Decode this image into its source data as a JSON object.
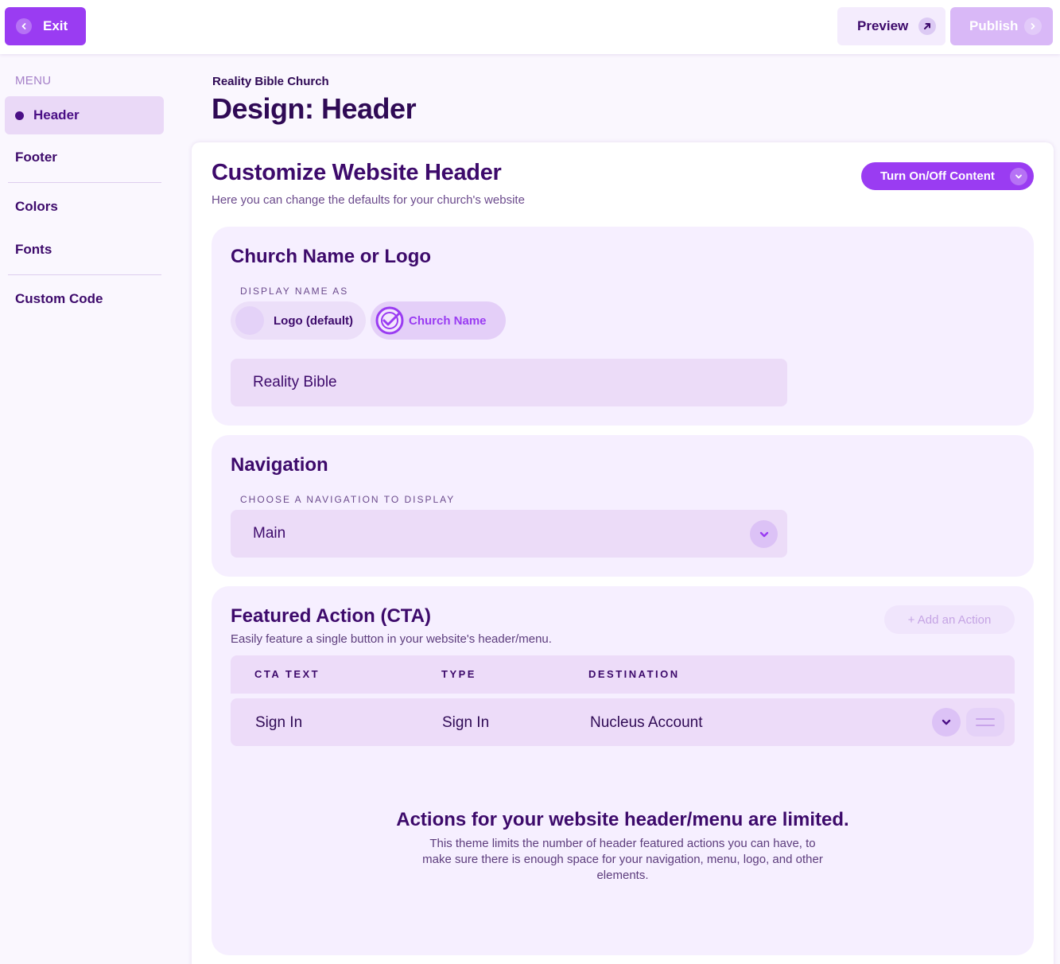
{
  "topbar": {
    "exit_label": "Exit",
    "preview_label": "Preview",
    "publish_label": "Publish"
  },
  "sidebar": {
    "menu_label": "MENU",
    "items": [
      {
        "label": "Header",
        "active": true
      },
      {
        "label": "Footer"
      },
      {
        "label": "Colors"
      },
      {
        "label": "Fonts"
      },
      {
        "label": "Custom Code"
      }
    ]
  },
  "page": {
    "org_name": "Reality Bible Church",
    "title": "Design: Header"
  },
  "card": {
    "title": "Customize Website Header",
    "subtitle": "Here you can change the defaults for your church's website",
    "toggle_label": "Turn On/Off Content"
  },
  "name_section": {
    "title": "Church Name or Logo",
    "label": "DISPLAY NAME AS",
    "options": [
      {
        "label": "Logo (default)",
        "selected": false
      },
      {
        "label": "Church Name",
        "selected": true
      }
    ],
    "name_value": "Reality Bible"
  },
  "nav_section": {
    "title": "Navigation",
    "label": "CHOOSE A NAVIGATION TO DISPLAY",
    "selected_value": "Main"
  },
  "cta_section": {
    "title": "Featured Action (CTA)",
    "description": "Easily feature a single button in your website's header/menu.",
    "add_label": "+ Add an Action",
    "columns": [
      "CTA TEXT",
      "TYPE",
      "DESTINATION"
    ],
    "rows": [
      {
        "text": "Sign In",
        "type": "Sign In",
        "destination": "Nucleus Account"
      }
    ],
    "limit_title": "Actions for your website header/menu are limited.",
    "limit_text": "This theme limits the number of header featured actions you can have, to make sure there is enough space for your navigation, menu, logo, and other elements."
  },
  "colors": {
    "accent": "#9a3cf2",
    "primary_text": "#3d0a6b",
    "section_bg": "#f6efff",
    "field_bg": "#ecdcf8"
  },
  "icons": {
    "exit": "chevron-left-icon",
    "preview": "arrow-up-right-icon",
    "publish": "chevron-right-icon",
    "toggle": "chevron-down-icon",
    "selected_option": "check-circle-icon",
    "row_drag": "drag-handle-icon"
  }
}
